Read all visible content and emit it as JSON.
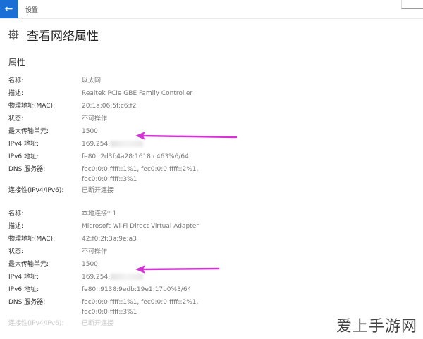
{
  "window": {
    "title": "设置",
    "back_icon": "back-arrow-icon",
    "accent": "#1a6fd6"
  },
  "header": {
    "icon": "gear-icon",
    "title": "查看网络属性"
  },
  "section": {
    "title": "属性"
  },
  "adapters": [
    {
      "rows": [
        {
          "label": "名称:",
          "value": "以太网"
        },
        {
          "label": "描述:",
          "value": "Realtek PCIe GBE Family Controller"
        },
        {
          "label": "物理地址(MAC):",
          "value": "20:1a:06:5f:c6:f2"
        },
        {
          "label": "状态:",
          "value": "不可操作"
        },
        {
          "label": "最大传输单元:",
          "value": "1500"
        },
        {
          "label": "IPv4 地址:",
          "value": "169.254."
        },
        {
          "label": "IPv6 地址:",
          "value": "fe80::2d3f:4a28:1618:c463%6/64"
        },
        {
          "label": "DNS 服务器:",
          "value": "fec0:0:0:ffff::1%1, fec0:0:0:ffff::2%1,\nfec0:0:0:ffff::3%1"
        },
        {
          "label": "连接性(IPv4/IPv6):",
          "value": "已断开连接"
        }
      ]
    },
    {
      "rows": [
        {
          "label": "名称:",
          "value": "本地连接* 1"
        },
        {
          "label": "描述:",
          "value": "Microsoft Wi-Fi Direct Virtual Adapter"
        },
        {
          "label": "物理地址(MAC):",
          "value": "42:f0:2f:3a:9e:a3"
        },
        {
          "label": "状态:",
          "value": "不可操作"
        },
        {
          "label": "最大传输单元:",
          "value": "1500"
        },
        {
          "label": "IPv4 地址:",
          "value": "169.254."
        },
        {
          "label": "IPv6 地址:",
          "value": "fe80::9138:9edb:19e1:17b0%3/64"
        },
        {
          "label": "DNS 服务器:",
          "value": "fec0:0:0:ffff::1%1, fec0:0:0:ffff::2%1,\nfec0:0:0:ffff::3%1"
        },
        {
          "label": "连接性(IPv4/IPv6):",
          "value": "已断开连接"
        }
      ]
    }
  ],
  "annotation": {
    "arrow_color": "#d633d6"
  },
  "watermark": {
    "text": "爱上手游网"
  }
}
